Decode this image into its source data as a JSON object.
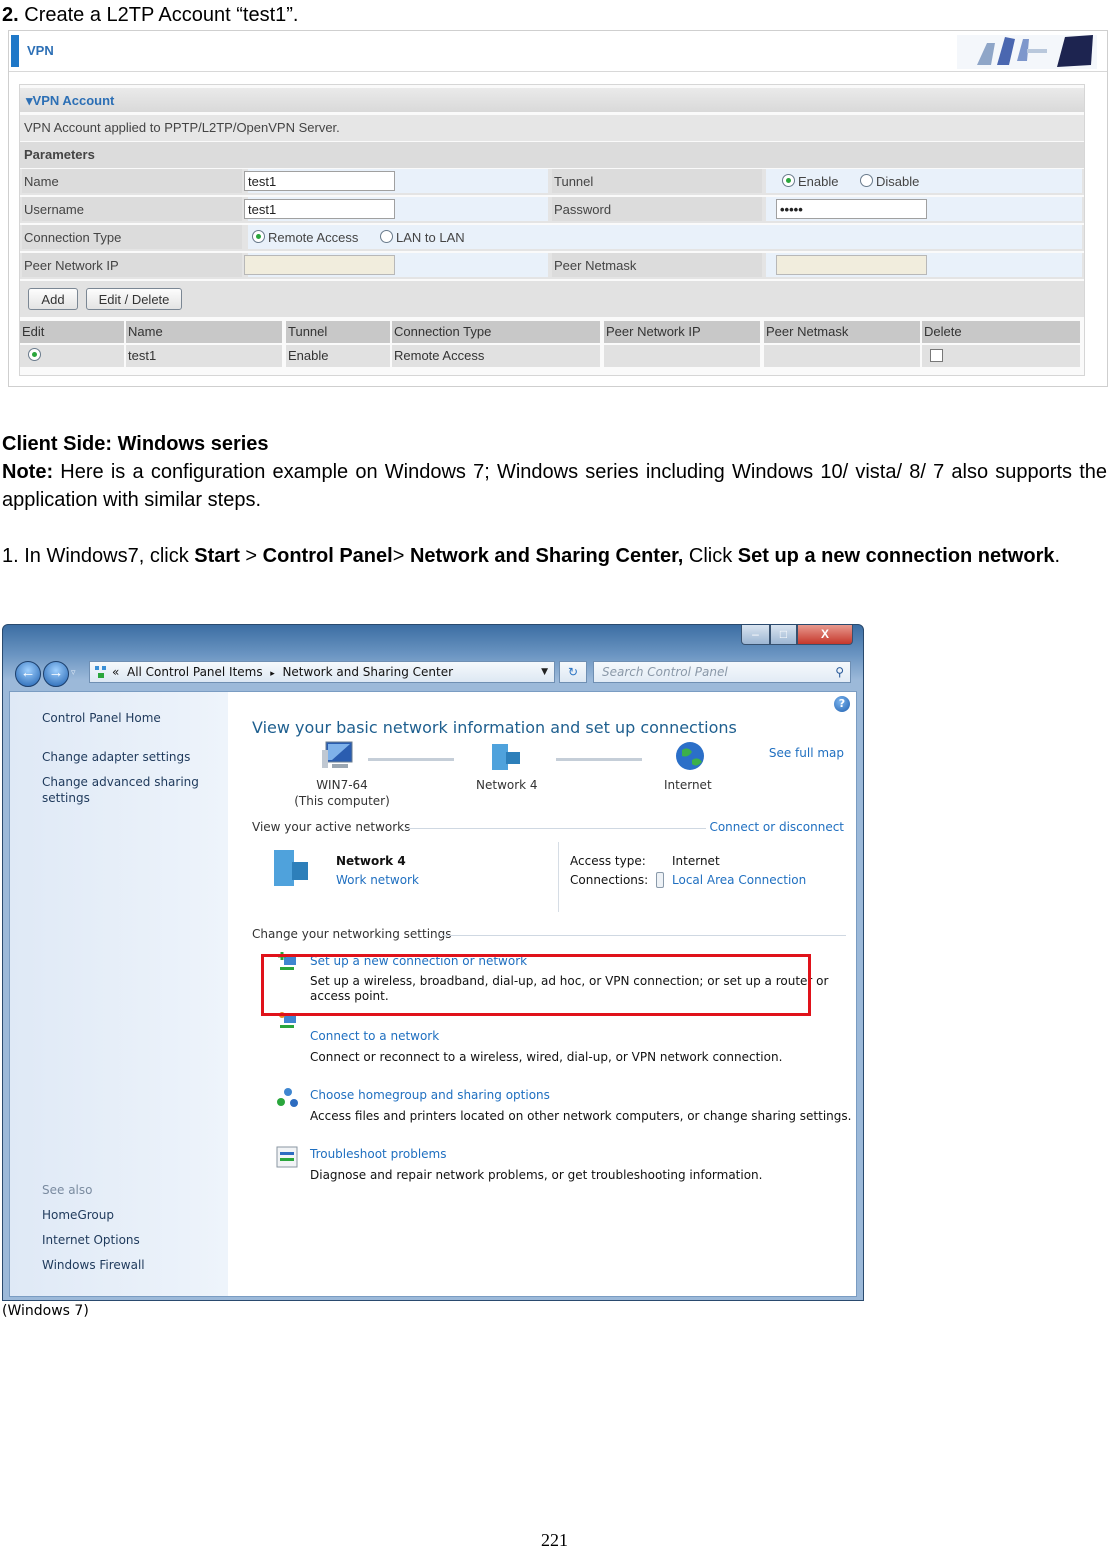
{
  "document": {
    "step_heading": {
      "number": "2.",
      "text": " Create a L2TP Account “test1”."
    },
    "client_heading": "Client Side:  Windows series",
    "note": {
      "label": "Note:",
      "text": " Here is a configuration example on Windows 7; Windows series including Windows 10/ vista/ 8/ 7 also supports the application with similar steps."
    },
    "step1": {
      "prefix": "1. In Windows7, click ",
      "start": "Start",
      "sep1": " > ",
      "control_panel": "Control Panel",
      "sep2": "> ",
      "nsc": "Network and Sharing Center,",
      "click": " Click ",
      "setup": "Set up a new connection network",
      "end": "."
    },
    "caption": "(Windows 7)",
    "page_number": "221"
  },
  "vpn": {
    "header_title": "VPN",
    "section_title": "VPN Account",
    "description": "VPN Account applied to PPTP/L2TP/OpenVPN Server.",
    "parameters_label": "Parameters",
    "fields": {
      "name_label": "Name",
      "name_value": "test1",
      "username_label": "Username",
      "username_value": "test1",
      "connection_type_label": "Connection Type",
      "remote_access": "Remote Access",
      "lan_to_lan": "LAN to LAN",
      "peer_network_ip_label": "Peer Network IP",
      "tunnel_label": "Tunnel",
      "enable": "Enable",
      "disable": "Disable",
      "password_label": "Password",
      "password_value": "•••••",
      "peer_netmask_label": "Peer Netmask"
    },
    "buttons": {
      "add": "Add",
      "edit_delete": "Edit / Delete"
    },
    "table": {
      "columns": [
        "Edit",
        "Name",
        "Tunnel",
        "Connection Type",
        "Peer Network IP",
        "Peer Netmask",
        "Delete"
      ],
      "rows": [
        {
          "name": "test1",
          "tunnel": "Enable",
          "connection_type": "Remote Access",
          "peer_network_ip": "",
          "peer_netmask": ""
        }
      ]
    }
  },
  "win7": {
    "caption_buttons": {
      "minimize": "–",
      "maximize": "□",
      "close": "X"
    },
    "breadcrumb": {
      "chevrons": "«",
      "item1": "All Control Panel Items",
      "arrow": "▸",
      "item2": "Network and Sharing Center"
    },
    "search_placeholder": "Search Control Panel",
    "left_pane": {
      "home": "Control Panel Home",
      "adapter": "Change adapter settings",
      "advanced": "Change advanced sharing settings",
      "see_also": "See also",
      "homegroup": "HomeGroup",
      "internet_options": "Internet Options",
      "firewall": "Windows Firewall"
    },
    "main": {
      "title": "View your basic network information and set up connections",
      "see_full_map": "See full map",
      "map": {
        "computer": "WIN7-64",
        "computer_sub": "(This computer)",
        "network": "Network  4",
        "internet": "Internet"
      },
      "active_networks_label": "View your active networks",
      "connect_disconnect": "Connect or disconnect",
      "network_name": "Network  4",
      "network_type": "Work network",
      "access_type_label": "Access type:",
      "access_type_value": "Internet",
      "connections_label": "Connections:",
      "connections_value": "Local Area Connection",
      "change_settings_label": "Change your networking settings",
      "tasks": [
        {
          "title": "Set up a new connection or network",
          "desc": "Set up a wireless, broadband, dial-up, ad hoc, or VPN connection; or set up a router or access point."
        },
        {
          "title": "Connect to a network",
          "desc": "Connect or reconnect to a wireless, wired, dial-up, or VPN network connection."
        },
        {
          "title": "Choose homegroup and sharing options",
          "desc": "Access files and printers located on other network computers, or change sharing settings."
        },
        {
          "title": "Troubleshoot problems",
          "desc": "Diagnose and repair network problems, or get troubleshooting information."
        }
      ]
    },
    "highlight_color": "#e0121a"
  }
}
